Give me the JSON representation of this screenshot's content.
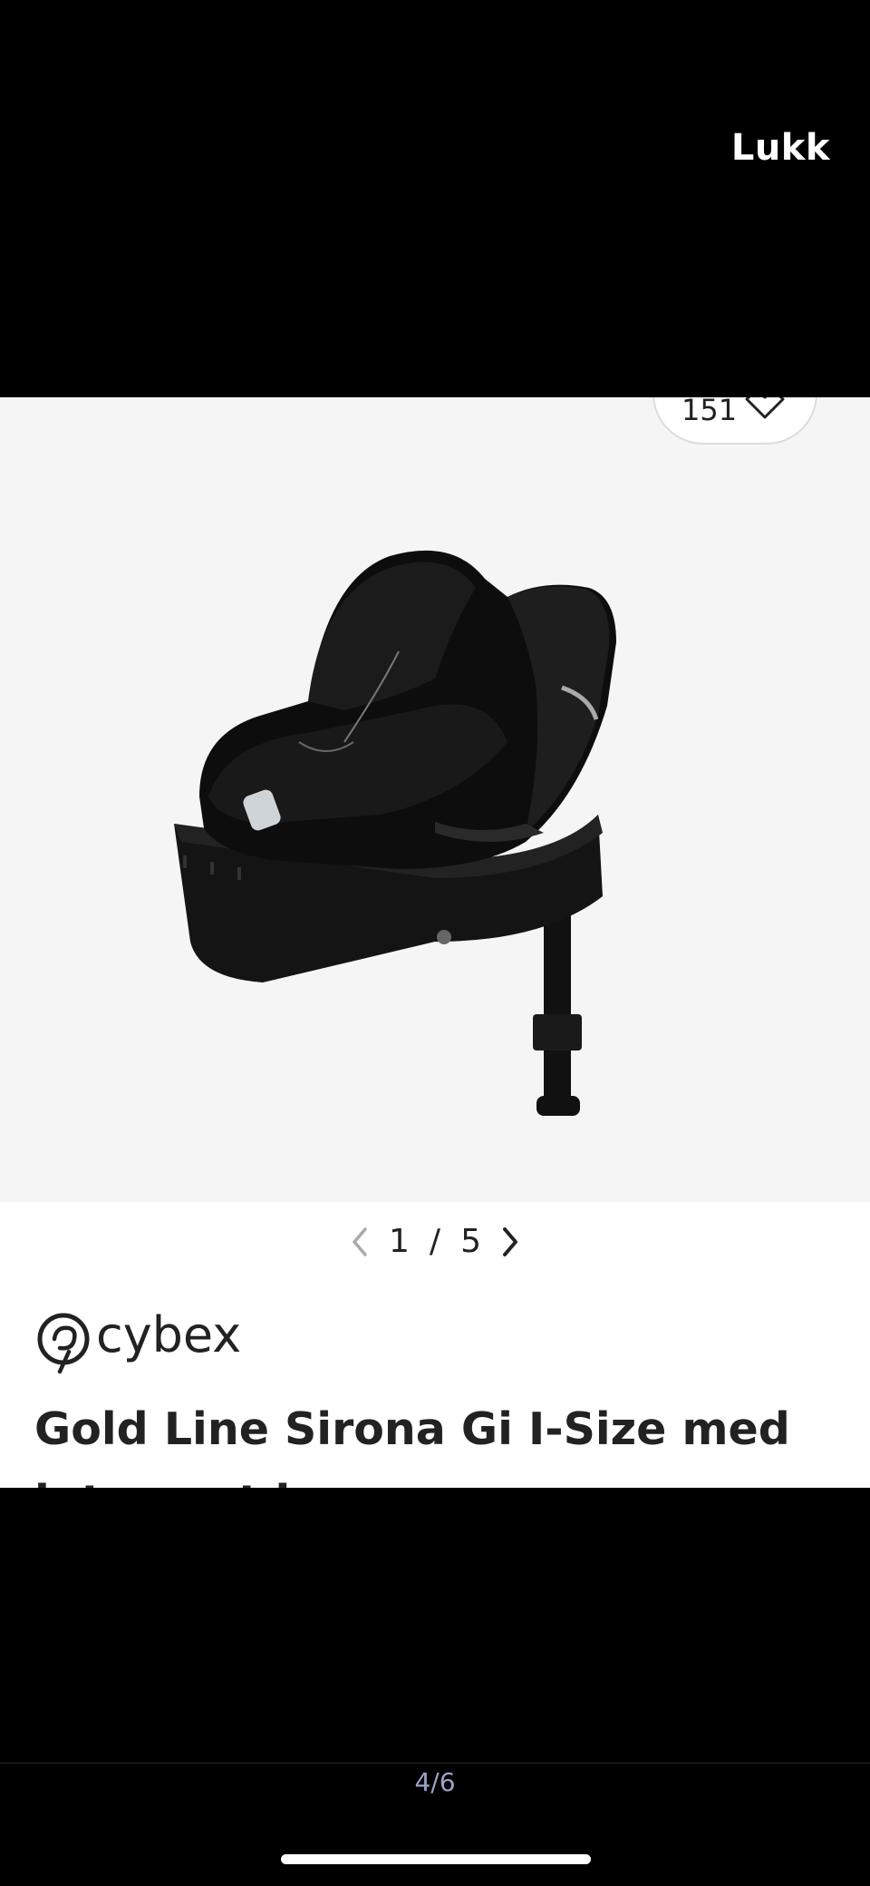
{
  "viewer": {
    "close_label": "Lukk",
    "page_indicator": "4/6"
  },
  "product": {
    "favorite_count": "151",
    "gallery": {
      "current": "1",
      "separator": "/",
      "total": "5"
    },
    "brand": "cybex",
    "title": "Gold Line Sirona Gi I-Size med integrert base"
  }
}
